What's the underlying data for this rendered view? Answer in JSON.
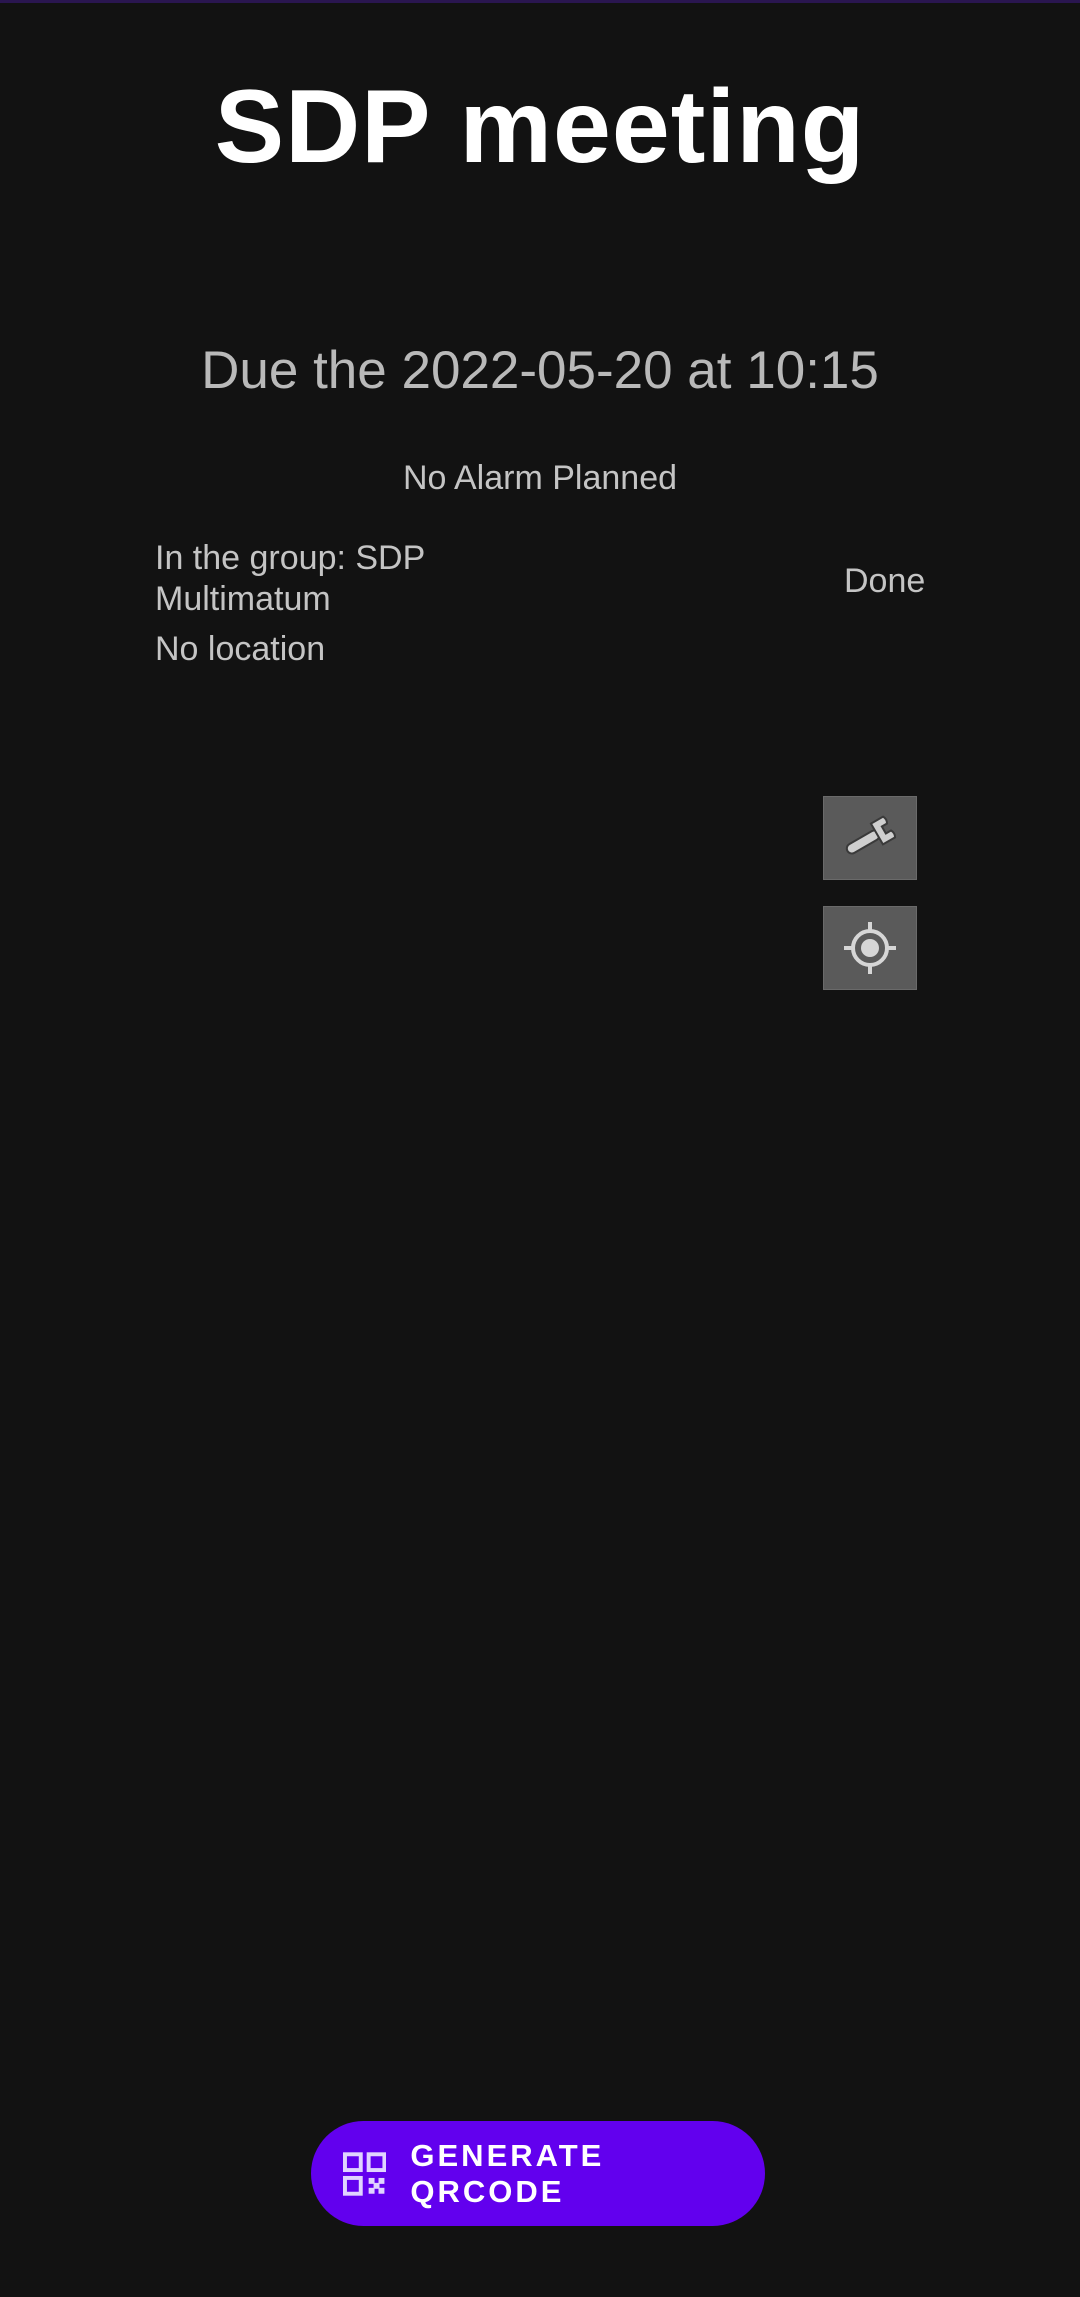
{
  "task": {
    "title": "SDP meeting",
    "due": "Due the 2022-05-20 at 10:15",
    "alarm": "No Alarm Planned",
    "group": "In the group: SDP Multimatum",
    "location": "No location",
    "status": "Done"
  },
  "actions": {
    "edit_icon": "wrench-icon",
    "locate_icon": "target-icon",
    "generate_qrcode_label": "GENERATE QRCODE",
    "generate_qrcode_icon": "qrcode-icon"
  },
  "colors": {
    "background": "#121212",
    "accent": "#6200ee",
    "text_primary": "#ffffff",
    "text_secondary": "#c4c4c4"
  }
}
